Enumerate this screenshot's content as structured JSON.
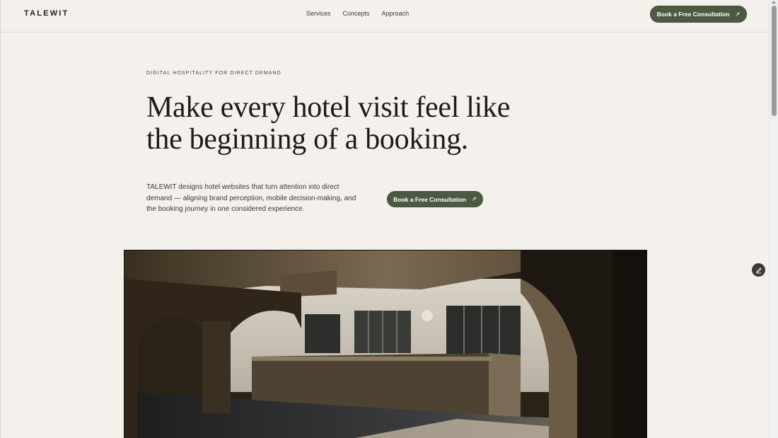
{
  "header": {
    "logo": "TALEWIT",
    "nav": [
      {
        "label": "Services"
      },
      {
        "label": "Concepts"
      },
      {
        "label": "Approach"
      }
    ],
    "cta_label": "Book a Free Consultation"
  },
  "hero": {
    "eyebrow": "DIGITAL HOSPITALITY FOR DIRECT DEMAND",
    "headline_line1": "Make every hotel visit feel like",
    "headline_line2": "the beginning of a booking.",
    "intro": "TALEWIT designs hotel websites that turn attention into direct demand — aligning brand perception, mobile decision-making, and the booking journey in one considered experience.",
    "cta_label": "Book a Free Consultation"
  },
  "icons": {
    "cta_arrow": "arrow-up-right-icon",
    "fab": "pencil-icon"
  },
  "colors": {
    "background": "#f4f1ec",
    "accent": "#4d5a43",
    "text": "#1c1c19"
  }
}
